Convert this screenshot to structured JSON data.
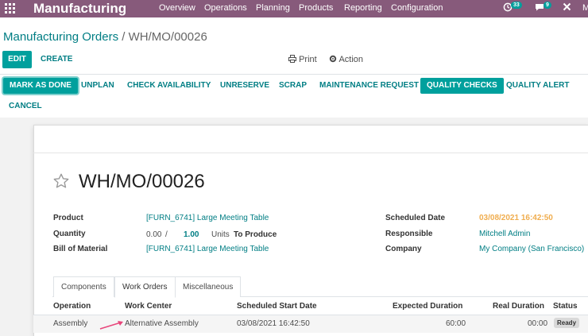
{
  "navbar": {
    "brand": "Manufacturing",
    "menu": [
      "Overview",
      "Operations",
      "Planning",
      "Products",
      "Reporting",
      "Configuration"
    ],
    "activity_count": "33",
    "message_count": "9",
    "user_initial": "M"
  },
  "breadcrumb": {
    "parent": "Manufacturing Orders",
    "separator": "/",
    "current": "WH/MO/00026"
  },
  "control": {
    "edit": "EDIT",
    "create": "CREATE",
    "print": "Print",
    "action": "Action"
  },
  "statusbar": {
    "buttons": [
      "MARK AS DONE",
      "UNPLAN",
      "CHECK AVAILABILITY",
      "UNRESERVE",
      "SCRAP",
      "MAINTENANCE REQUEST",
      "QUALITY CHECKS",
      "QUALITY ALERT",
      "CANCEL"
    ]
  },
  "record": {
    "title": "WH/MO/00026",
    "product_label": "Product",
    "product_value": "[FURN_6741] Large Meeting Table",
    "quantity_label": "Quantity",
    "quantity_done": "0.00",
    "quantity_sep": "/",
    "quantity_target": "1.00",
    "quantity_uom": "Units",
    "quantity_suffix": "To Produce",
    "bom_label": "Bill of Material",
    "bom_value": "[FURN_6741] Large Meeting Table",
    "scheduled_label": "Scheduled Date",
    "scheduled_value": "03/08/2021 16:42:50",
    "responsible_label": "Responsible",
    "responsible_value": "Mitchell Admin",
    "company_label": "Company",
    "company_value": "My Company (San Francisco)"
  },
  "tabs": [
    "Components",
    "Work Orders",
    "Miscellaneous"
  ],
  "workorders": {
    "headers": [
      "Operation",
      "Work Center",
      "Scheduled Start Date",
      "Expected Duration",
      "Real Duration",
      "Status"
    ],
    "rows": [
      {
        "operation": "Assembly",
        "workcenter": "Alternative Assembly",
        "start": "03/08/2021 16:42:50",
        "expected": "60:00",
        "real": "00:00",
        "status": "Ready"
      }
    ]
  },
  "colors": {
    "navbar": "#875a7b",
    "primary": "#00a09d",
    "link": "#017e84",
    "scheduled": "#f0ad4e",
    "annotation_arrow": "#e8457b"
  }
}
